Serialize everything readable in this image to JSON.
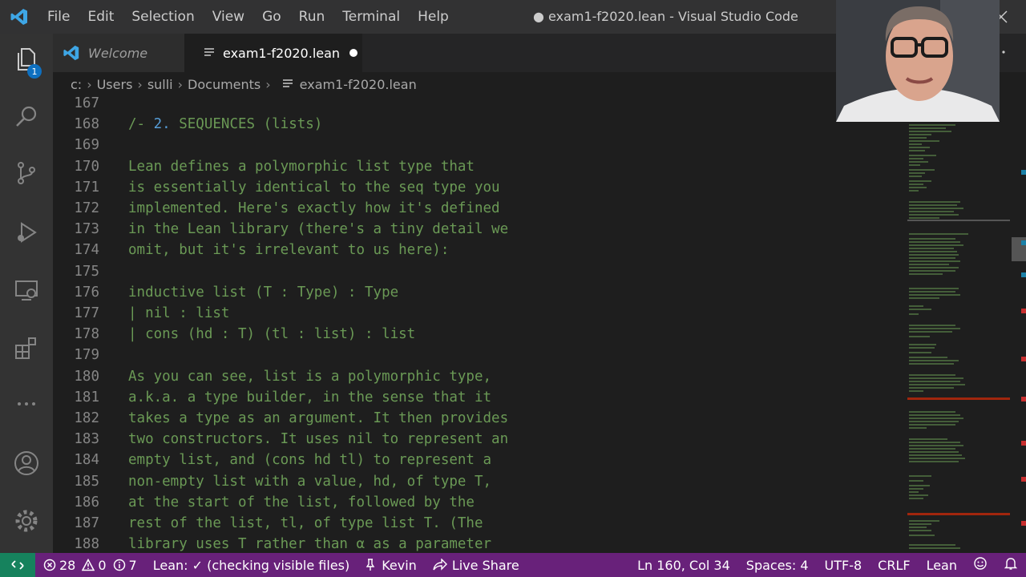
{
  "window": {
    "title": "● exam1-f2020.lean - Visual Studio Code",
    "menu": [
      "File",
      "Edit",
      "Selection",
      "View",
      "Go",
      "Run",
      "Terminal",
      "Help"
    ]
  },
  "activity_bar": {
    "explorer_badge": "1"
  },
  "tabs": [
    {
      "label": "Welcome"
    },
    {
      "label": "exam1-f2020.lean",
      "modified": true
    }
  ],
  "breadcrumb": [
    "c:",
    "Users",
    "sulli",
    "Documents",
    "exam1-f2020.lean"
  ],
  "editor": {
    "lines": [
      {
        "n": "167",
        "text": ""
      },
      {
        "n": "168",
        "text": "/- 2. SEQUENCES (lists)"
      },
      {
        "n": "169",
        "text": ""
      },
      {
        "n": "170",
        "text": "Lean defines a polymorphic list type that"
      },
      {
        "n": "171",
        "text": "is essentially identical to the seq type you"
      },
      {
        "n": "172",
        "text": "implemented. Here's exactly how it's defined"
      },
      {
        "n": "173",
        "text": "in the Lean library (there's a tiny detail we"
      },
      {
        "n": "174",
        "text": "omit, but it's irrelevant to us here):"
      },
      {
        "n": "175",
        "text": ""
      },
      {
        "n": "176",
        "text": "inductive list (T : Type) : Type"
      },
      {
        "n": "177",
        "text": "| nil : list"
      },
      {
        "n": "178",
        "text": "| cons (hd : T) (tl : list) : list"
      },
      {
        "n": "179",
        "text": ""
      },
      {
        "n": "180",
        "text": "As you can see, list is a polymorphic type,"
      },
      {
        "n": "181",
        "text": "a.k.a. a type builder, in the sense that it"
      },
      {
        "n": "182",
        "text": "takes a type as an argument. It then provides"
      },
      {
        "n": "183",
        "text": "two constructors. It uses nil to represent an"
      },
      {
        "n": "184",
        "text": "empty list, and (cons hd tl) to represent a"
      },
      {
        "n": "185",
        "text": "non-empty list with a value, hd, of type T,"
      },
      {
        "n": "186",
        "text": "at the start of the list, followed by the"
      },
      {
        "n": "187",
        "text": "rest of the list, tl, of type list T. (The"
      },
      {
        "n": "188",
        "text": "library uses T rather than α as a parameter"
      }
    ]
  },
  "status_bar": {
    "errors": "28",
    "warnings": "0",
    "infos": "7",
    "lean_status": "Lean: ✓ (checking visible files)",
    "user": "Kevin",
    "live_share": "Live Share",
    "cursor": "Ln 160, Col 34",
    "spaces": "Spaces: 4",
    "encoding": "UTF-8",
    "eol": "CRLF",
    "language": "Lean"
  },
  "colors": {
    "status_bar": "#68217a",
    "remote": "#16825d",
    "comment": "#6a9955",
    "badge": "#0e70c0"
  }
}
